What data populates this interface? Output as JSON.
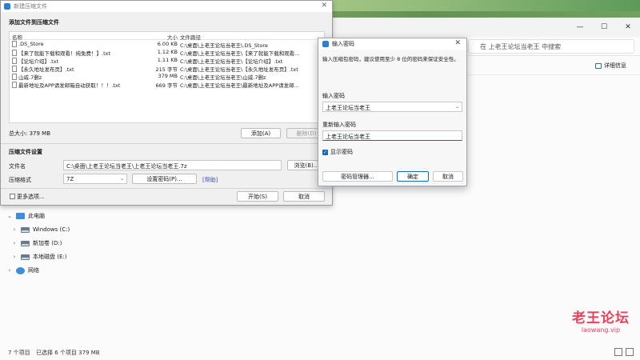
{
  "explorer": {
    "search_placeholder": "在 上老王论坛当老王 中搜索",
    "detail_info": "详细信息",
    "window_buttons": [
      "—",
      "☐",
      "✕"
    ],
    "tree": [
      {
        "label": "此电脑",
        "indent": 0
      },
      {
        "label": "Windows (C:)",
        "indent": 1
      },
      {
        "label": "新加卷 (D:)",
        "indent": 1
      },
      {
        "label": "本地磁盘 (E:)",
        "indent": 1
      },
      {
        "label": "网络",
        "indent": 0
      }
    ],
    "status": {
      "count": "7 个项目",
      "selected": "已选择 6 个项目  379 MB"
    }
  },
  "watermark": {
    "title": "老王论坛",
    "sub": "laowang.vip"
  },
  "archive": {
    "title": "新建压缩文件",
    "add_section": "添加文件到压缩文件",
    "columns": {
      "name": "名称",
      "size": "大小",
      "path": "文件路径"
    },
    "files": [
      {
        "name": ".DS_Store",
        "size": "6.00 KB",
        "path": "C:\\桌面\\上老王论坛当老王\\.DS_Store"
      },
      {
        "name": "【来了就能下载和观看！纯免费！】.txt",
        "size": "1.12 KB",
        "path": "C:\\桌面\\上老王论坛当老王\\【来了就能下载和观看..."
      },
      {
        "name": "【论坛介绍】.txt",
        "size": "1.11 KB",
        "path": "C:\\桌面\\上老王论坛当老王\\【论坛介绍】.txt"
      },
      {
        "name": "【永久地址发布页】.txt",
        "size": "215 字节",
        "path": "C:\\桌面\\上老王论坛当老王\\【永久地址发布页】.txt"
      },
      {
        "name": "山威.7删z",
        "size": "379 MB",
        "path": "C:\\桌面\\上老王论坛当老王\\山威.7删z"
      },
      {
        "name": "最新地址及APP请发邮箱自动获取！！！.txt",
        "size": "669 字节",
        "path": "C:\\桌面\\上老王论坛当老王\\最新地址及APP请发邮..."
      }
    ],
    "total": "总大小: 379 MB",
    "add_button": "添加(A)",
    "delete_button": "删除(D)",
    "settings_section": "压缩文件设置",
    "filename_label": "文件名",
    "filename_value": "C:\\桌面\\上老王论坛当老王\\上老王论坛当老王.7z",
    "browse_button": "浏览(B)...",
    "format_label": "压缩格式",
    "format_value": "7Z",
    "set_password_button": "设置密码(P)...",
    "help_link": "[帮助]",
    "more_options": "更多选项...",
    "start_button": "开始(S)",
    "cancel_button": "取消"
  },
  "password_dialog": {
    "title": "输入密码",
    "hint": "输入压缩包密码，建议使用至少 8 位的密码来保证安全性。",
    "enter_label": "输入密码",
    "enter_value": "上老王论坛当老王",
    "reenter_label": "重新输入密码",
    "reenter_value": "上老王论坛当老王",
    "show_password": "显示密码",
    "show_password_checked": true,
    "manager_button": "密码管理器...",
    "ok_button": "确定",
    "cancel_button": "取消"
  }
}
